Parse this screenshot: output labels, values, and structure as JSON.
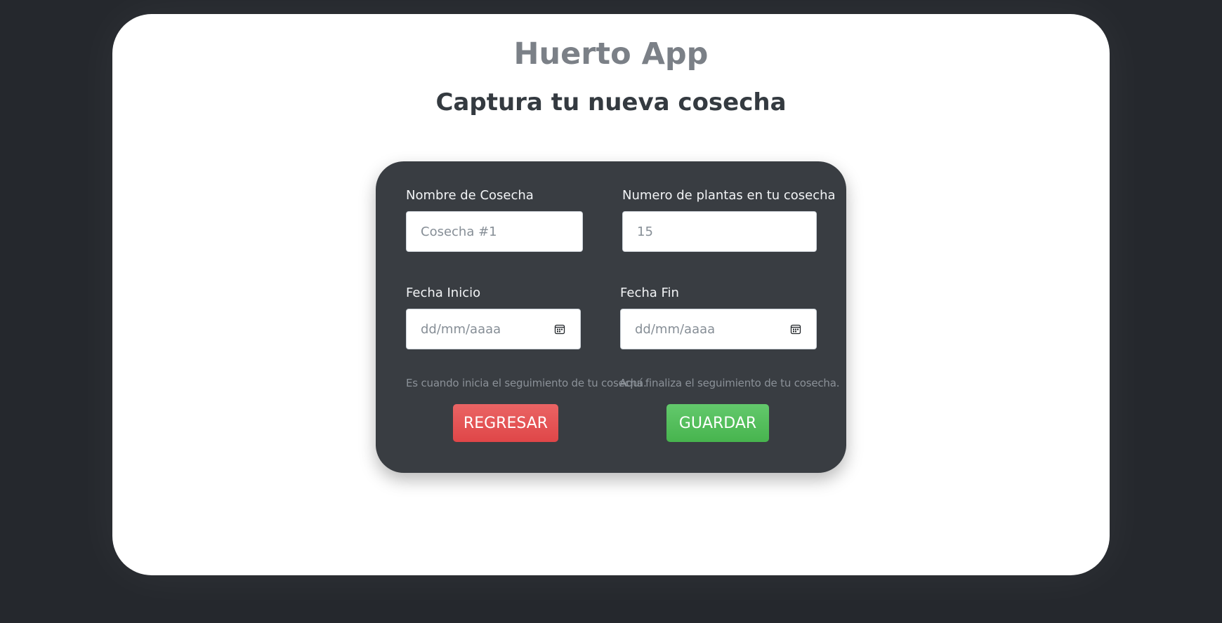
{
  "header": {
    "app_title": "Huerto App",
    "subtitle": "Captura tu nueva cosecha"
  },
  "form": {
    "harvest_name": {
      "label": "Nombre de Cosecha",
      "placeholder": "Cosecha #1"
    },
    "plant_count": {
      "label": "Numero de plantas en tu cosecha",
      "placeholder": "15"
    },
    "start_date": {
      "label": "Fecha Inicio",
      "placeholder": "dd/mm/aaaa",
      "help": "Es cuando inicia el seguimiento de tu cosecha."
    },
    "end_date": {
      "label": "Fecha Fin",
      "placeholder": "dd/mm/aaaa",
      "help": "Aquí finaliza el seguimiento de tu cosecha."
    },
    "back_button_label": "REGRESAR",
    "save_button_label": "GUARDAR"
  },
  "icons": {
    "calendar": "calendar-icon"
  },
  "colors": {
    "background": "#25282d",
    "card": "#ffffff",
    "panel": "#393d42",
    "back_button": "#df4648",
    "save_button": "#47b44e",
    "title": "#7b8087",
    "subtitle": "#343a40"
  }
}
